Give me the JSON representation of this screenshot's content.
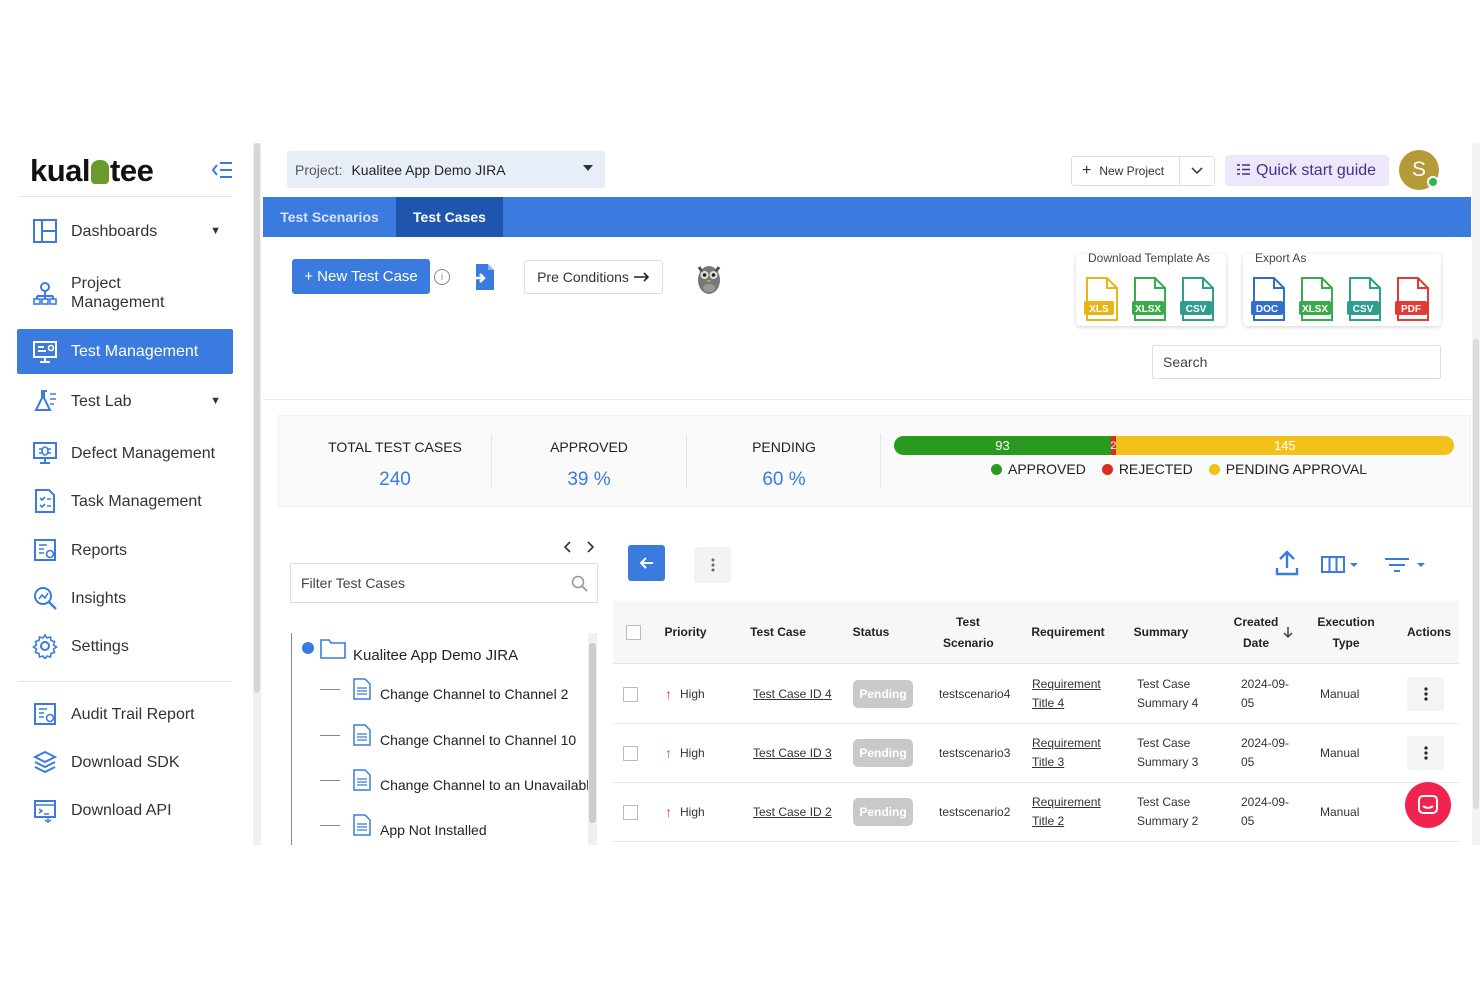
{
  "brand": {
    "logo_left": "kual",
    "logo_right": "tee"
  },
  "sidebar": {
    "items": [
      {
        "label": "Dashboards",
        "icon": "dashboard-icon"
      },
      {
        "label": "Project Management",
        "icon": "project-icon"
      },
      {
        "label": "Test Management",
        "icon": "test-management-icon"
      },
      {
        "label": "Test Lab",
        "icon": "flask-icon"
      },
      {
        "label": "Defect Management",
        "icon": "bug-icon"
      },
      {
        "label": "Task Management",
        "icon": "task-icon"
      },
      {
        "label": "Reports",
        "icon": "report-icon"
      },
      {
        "label": "Insights",
        "icon": "insights-icon"
      },
      {
        "label": "Settings",
        "icon": "gear-icon"
      }
    ],
    "footer_items": [
      {
        "label": "Audit Trail Report",
        "icon": "audit-icon"
      },
      {
        "label": "Download SDK",
        "icon": "sdk-icon"
      },
      {
        "label": "Download API",
        "icon": "api-icon"
      }
    ]
  },
  "header": {
    "project_label": "Project:",
    "project_value": "Kualitee App Demo JIRA",
    "new_project": "New Project",
    "quick_start": "Quick start guide",
    "avatar_initial": "S"
  },
  "tabs": [
    {
      "label": "Test Scenarios",
      "active": false
    },
    {
      "label": "Test Cases",
      "active": true
    }
  ],
  "toolbar": {
    "new_test_case": "+ New Test Case",
    "info": "i",
    "pre_conditions": "Pre Conditions",
    "download_template_title": "Download Template As",
    "export_title": "Export As",
    "template_formats": [
      "XLS",
      "XLSX",
      "CSV"
    ],
    "export_formats": [
      "DOC",
      "XLSX",
      "CSV",
      "PDF"
    ],
    "search_placeholder": "Search"
  },
  "stats": {
    "total_label": "TOTAL TEST CASES",
    "total_value": "240",
    "approved_label": "APPROVED",
    "approved_value": "39 %",
    "pending_label": "PENDING",
    "pending_value": "60 %",
    "bar": {
      "approved": 93,
      "rejected": 2,
      "pending": 145,
      "colors": {
        "approved": "#2a9a1e",
        "rejected": "#e02a24",
        "pending": "#f2c21a"
      }
    },
    "legend": [
      "APPROVED",
      "REJECTED",
      "PENDING APPROVAL"
    ]
  },
  "tree": {
    "filter_placeholder": "Filter Test Cases",
    "root": "Kualitee App Demo JIRA",
    "items": [
      "Change Channel to Channel 2",
      "Change Channel to Channel 10",
      "Change Channel to an Unavailable",
      "App Not Installed"
    ]
  },
  "table": {
    "columns": [
      "Priority",
      "Test Case",
      "Status",
      "Test Scenario",
      "Requirement",
      "Summary",
      "Created Date",
      "Execution Type",
      "Actions"
    ],
    "rows": [
      {
        "priority": "High",
        "test_case": "Test Case ID 4",
        "status": "Pending",
        "scenario": "testscenario4",
        "req_line1": "Requirement",
        "req_line2": "Title 4",
        "sum_line1": "Test Case",
        "sum_line2": "Summary 4",
        "date_line1": "2024-09-",
        "date_line2": "05",
        "exec": "Manual"
      },
      {
        "priority": "High",
        "test_case": "Test Case ID 3",
        "status": "Pending",
        "scenario": "testscenario3",
        "req_line1": "Requirement",
        "req_line2": "Title 3",
        "sum_line1": "Test Case",
        "sum_line2": "Summary 3",
        "date_line1": "2024-09-",
        "date_line2": "05",
        "exec": "Manual"
      },
      {
        "priority": "High",
        "test_case": "Test Case ID 2",
        "status": "Pending",
        "scenario": "testscenario2",
        "req_line1": "Requirement",
        "req_line2": "Title 2",
        "sum_line1": "Test Case",
        "sum_line2": "Summary 2",
        "date_line1": "2024-09-",
        "date_line2": "05",
        "exec": "Manual"
      }
    ]
  }
}
